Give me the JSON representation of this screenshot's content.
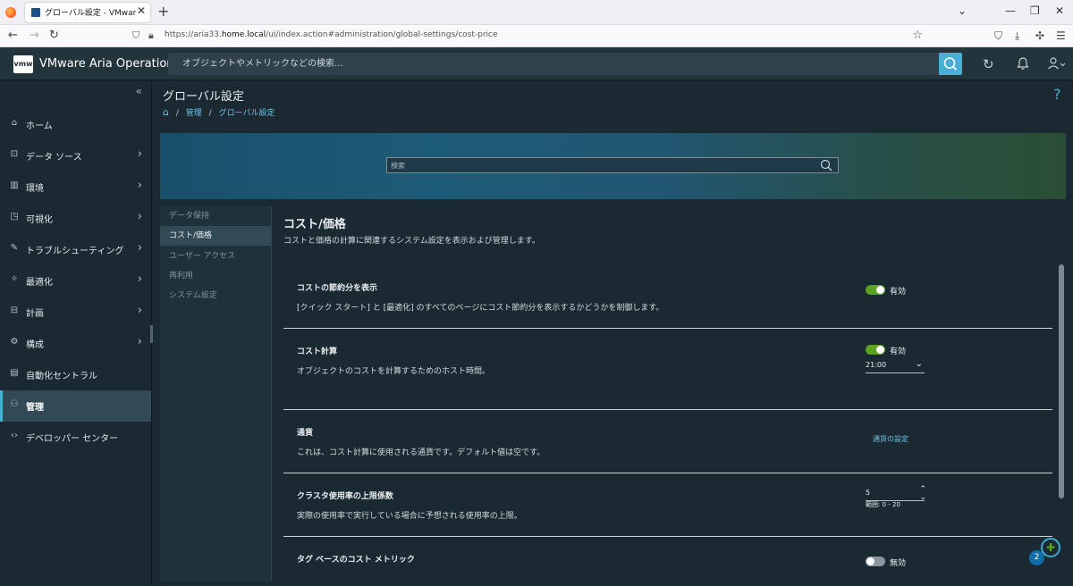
{
  "browser": {
    "tab_title": "グローバル設定 - VMware Aria Op",
    "url_prefix": "https://aria33.",
    "url_host": "home.local",
    "url_path": "/ui/index.action#administration/global-settings/cost-price"
  },
  "header": {
    "logo": "vmw",
    "app_title": "VMware Aria Operations",
    "search_placeholder": "オブジェクトやメトリックなどの検索..."
  },
  "sidebar": {
    "items": [
      {
        "label": "ホーム",
        "icon": "home-icon",
        "chevron": false
      },
      {
        "label": "データ ソース",
        "icon": "plug-icon",
        "chevron": true
      },
      {
        "label": "環境",
        "icon": "building-icon",
        "chevron": true
      },
      {
        "label": "可視化",
        "icon": "chart-icon",
        "chevron": true
      },
      {
        "label": "トラブルシューティング",
        "icon": "wrench-icon",
        "chevron": true
      },
      {
        "label": "最適化",
        "icon": "magic-icon",
        "chevron": true
      },
      {
        "label": "計画",
        "icon": "briefcase-icon",
        "chevron": true
      },
      {
        "label": "構成",
        "icon": "gear-icon",
        "chevron": true
      },
      {
        "label": "自動化セントラル",
        "icon": "calendar-icon",
        "chevron": false
      },
      {
        "label": "管理",
        "icon": "admin-icon",
        "chevron": false,
        "active": true
      },
      {
        "label": "デベロッパー センター",
        "icon": "code-icon",
        "chevron": false
      }
    ]
  },
  "page": {
    "title": "グローバル設定",
    "breadcrumb": [
      "管理",
      "グローバル設定"
    ],
    "banner_search_placeholder": "検索"
  },
  "subnav": {
    "items": [
      {
        "label": "データ保持",
        "active": false
      },
      {
        "label": "コスト/価格",
        "active": true
      },
      {
        "label": "ユーザー アクセス",
        "active": false
      },
      {
        "label": "再利用",
        "active": false
      },
      {
        "label": "システム設定",
        "active": false
      }
    ]
  },
  "panel": {
    "title": "コスト/価格",
    "description": "コストと価格の計算に関連するシステム設定を表示および管理します。",
    "settings": {
      "savings": {
        "name": "コストの節約分を表示",
        "description": "[クイック スタート] と [最適化] のすべてのページにコスト節約分を表示するかどうかを制御します。",
        "toggle_label": "有効",
        "enabled": true
      },
      "cost_calc": {
        "name": "コスト計算",
        "description": "オブジェクトのコストを計算するためのホスト時間。",
        "toggle_label": "有効",
        "enabled": true,
        "time_value": "21:00"
      },
      "currency": {
        "name": "通貨",
        "description": "これは、コスト計算に使用される通貨です。デフォルト値は空です。",
        "link": "通貨の設定"
      },
      "cluster": {
        "name": "クラスタ使用率の上限係数",
        "description": "実際の使用率で実行している場合に予想される使用率の上限。",
        "value": "5",
        "range": "範囲: 0 - 20"
      },
      "tag": {
        "name": "タグ ベースのコスト メトリック",
        "toggle_label": "無効",
        "enabled": false
      }
    }
  },
  "badge_count": "2"
}
